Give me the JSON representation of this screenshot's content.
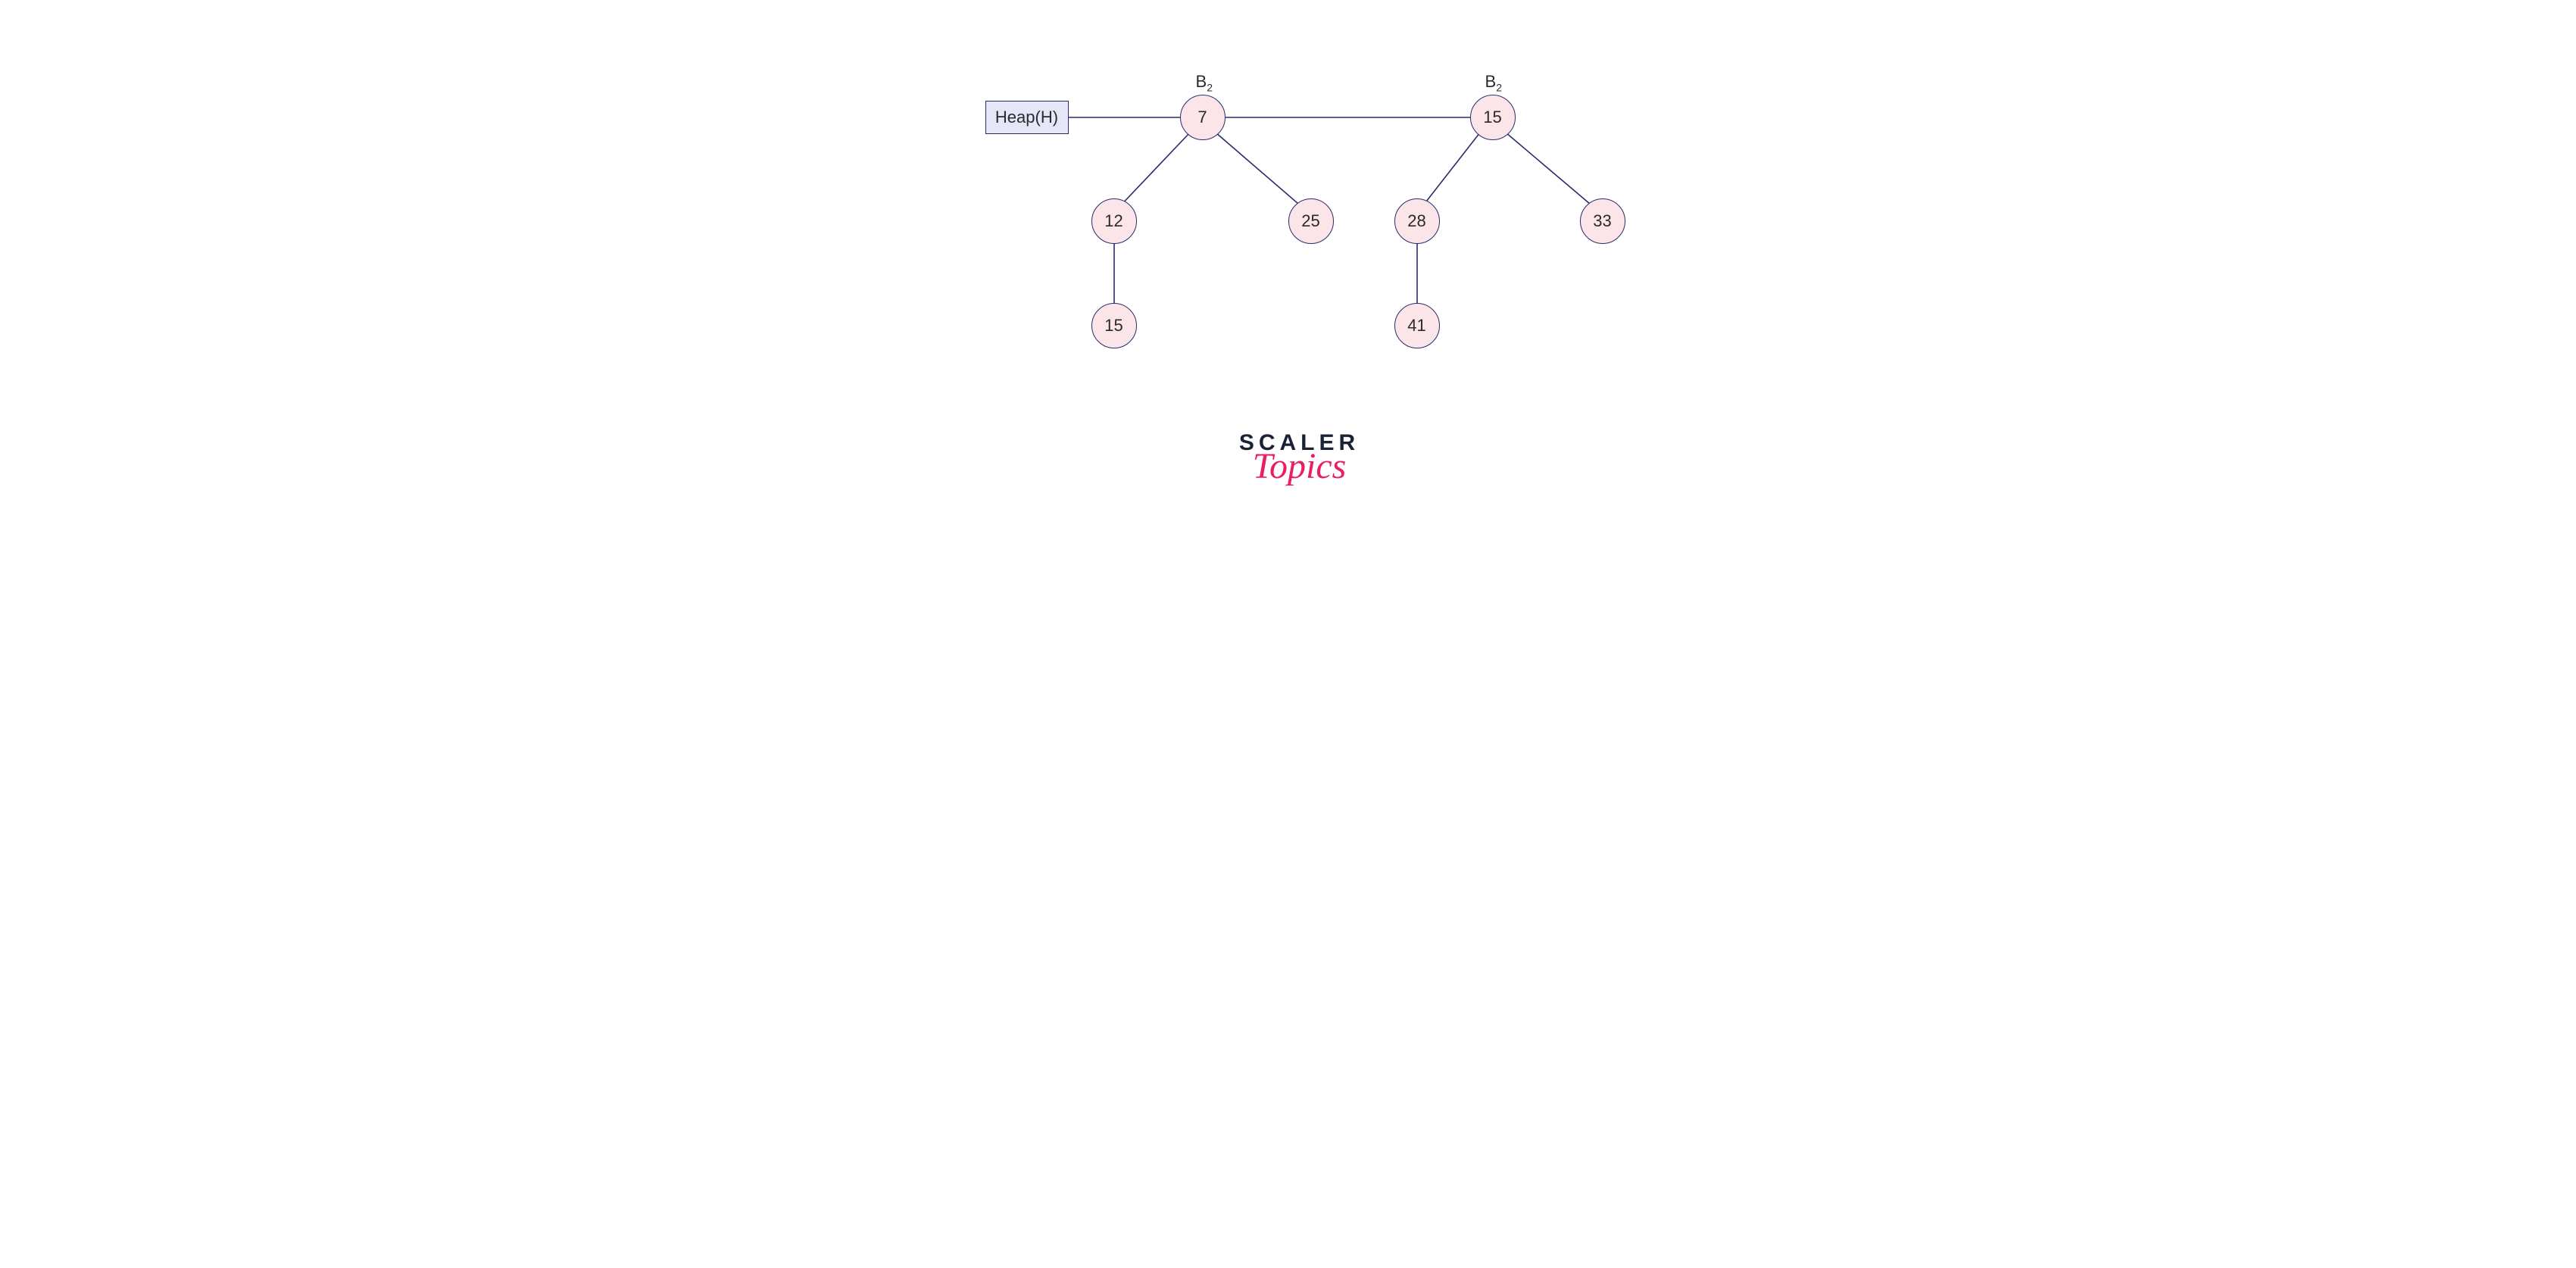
{
  "heap_label": "Heap(H)",
  "tree1": {
    "order_label_base": "B",
    "order_label_sub": "2",
    "root": "7",
    "left": "12",
    "right": "25",
    "left_child": "15"
  },
  "tree2": {
    "order_label_base": "B",
    "order_label_sub": "2",
    "root": "15",
    "left": "28",
    "right": "33",
    "left_child": "41"
  },
  "logo": {
    "line1": "SCALER",
    "line2": "Topics"
  },
  "colors": {
    "node_fill": "#fbe5e8",
    "node_stroke": "#2b2b6b",
    "heap_fill": "#e5e6f7",
    "edge": "#2b2b6b",
    "logo_dark": "#1a2236",
    "logo_pink": "#e91e63"
  }
}
